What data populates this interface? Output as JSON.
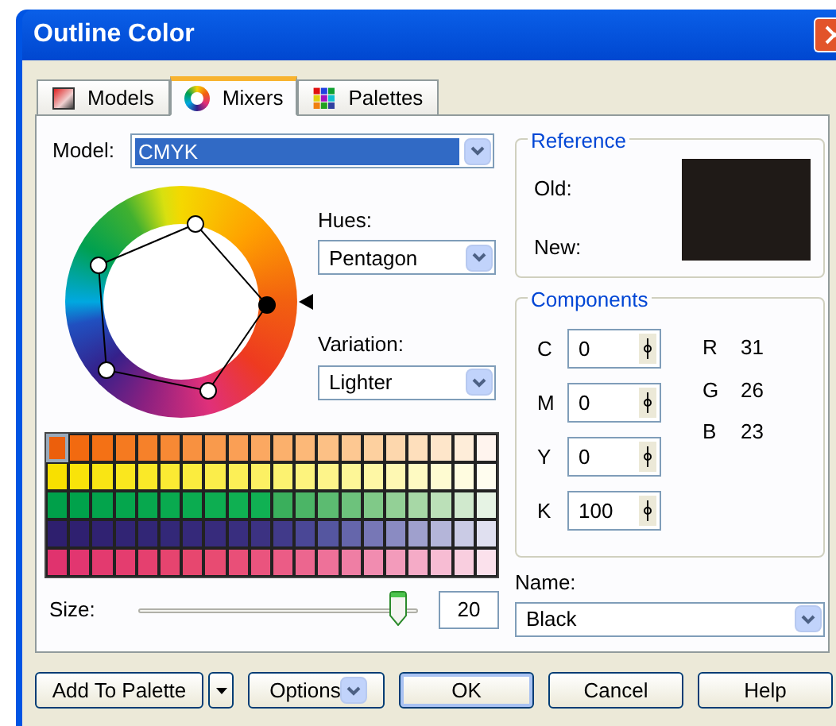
{
  "window": {
    "title": "Outline Color"
  },
  "tabs": [
    {
      "label": "Models",
      "selected": false,
      "kind": "models"
    },
    {
      "label": "Mixers",
      "selected": true,
      "kind": "mixers"
    },
    {
      "label": "Palettes",
      "selected": false,
      "kind": "palettes"
    }
  ],
  "model": {
    "label": "Model:",
    "value": "CMYK"
  },
  "hues": {
    "label": "Hues:",
    "value": "Pentagon"
  },
  "variation": {
    "label": "Variation:",
    "value": "Lighter"
  },
  "swatch_rows": [
    [
      {
        "color": "#ec5f0c",
        "selected": true
      },
      {
        "color": "#f26a10",
        "selected": false
      },
      {
        "color": "#f47115",
        "selected": false
      },
      {
        "color": "#f57a20",
        "selected": false
      },
      {
        "color": "#f6812a",
        "selected": false
      },
      {
        "color": "#f78934",
        "selected": false
      },
      {
        "color": "#f89140",
        "selected": false
      },
      {
        "color": "#f99a4c",
        "selected": false
      },
      {
        "color": "#fa9f55",
        "selected": false
      },
      {
        "color": "#fba861",
        "selected": false
      },
      {
        "color": "#fbb06c",
        "selected": false
      },
      {
        "color": "#fcb878",
        "selected": false
      },
      {
        "color": "#fcc085",
        "selected": false
      },
      {
        "color": "#fdc892",
        "selected": false
      },
      {
        "color": "#fdd09f",
        "selected": false
      },
      {
        "color": "#fdd7ad",
        "selected": false
      },
      {
        "color": "#fedfbc",
        "selected": false
      },
      {
        "color": "#fee6ca",
        "selected": false
      },
      {
        "color": "#feedd9",
        "selected": false
      },
      {
        "color": "#fff4ee",
        "selected": false
      }
    ],
    [
      {
        "color": "#f8e000",
        "selected": false
      },
      {
        "color": "#f9e30a",
        "selected": false
      },
      {
        "color": "#f9e514",
        "selected": false
      },
      {
        "color": "#fae71e",
        "selected": false
      },
      {
        "color": "#fae928",
        "selected": false
      },
      {
        "color": "#fbea33",
        "selected": false
      },
      {
        "color": "#fbec3e",
        "selected": false
      },
      {
        "color": "#fbed4a",
        "selected": false
      },
      {
        "color": "#fcef56",
        "selected": false
      },
      {
        "color": "#fcf063",
        "selected": false
      },
      {
        "color": "#fcf270",
        "selected": false
      },
      {
        "color": "#fdf37d",
        "selected": false
      },
      {
        "color": "#fdf48a",
        "selected": false
      },
      {
        "color": "#fdf697",
        "selected": false
      },
      {
        "color": "#fef7a5",
        "selected": false
      },
      {
        "color": "#fef8b3",
        "selected": false
      },
      {
        "color": "#fefac2",
        "selected": false
      },
      {
        "color": "#fefbd1",
        "selected": false
      },
      {
        "color": "#fffce0",
        "selected": false
      },
      {
        "color": "#fffdef",
        "selected": false
      }
    ],
    [
      {
        "color": "#00a04a",
        "selected": false
      },
      {
        "color": "#00a24b",
        "selected": false
      },
      {
        "color": "#03a44c",
        "selected": false
      },
      {
        "color": "#05a64d",
        "selected": false
      },
      {
        "color": "#07a84e",
        "selected": false
      },
      {
        "color": "#09aa4f",
        "selected": false
      },
      {
        "color": "#0bac50",
        "selected": false
      },
      {
        "color": "#0dae51",
        "selected": false
      },
      {
        "color": "#0fb052",
        "selected": false
      },
      {
        "color": "#10b153",
        "selected": false
      },
      {
        "color": "#3aaf5c",
        "selected": false
      },
      {
        "color": "#4bb566",
        "selected": false
      },
      {
        "color": "#5cbb71",
        "selected": false
      },
      {
        "color": "#6dc27c",
        "selected": false
      },
      {
        "color": "#80c988",
        "selected": false
      },
      {
        "color": "#93d096",
        "selected": false
      },
      {
        "color": "#a7d8a6",
        "selected": false
      },
      {
        "color": "#bbe0b8",
        "selected": false
      },
      {
        "color": "#d0e9cd",
        "selected": false
      },
      {
        "color": "#e6f3e4",
        "selected": false
      }
    ],
    [
      {
        "color": "#2e1f6e",
        "selected": false
      },
      {
        "color": "#2f2070",
        "selected": false
      },
      {
        "color": "#302272",
        "selected": false
      },
      {
        "color": "#312474",
        "selected": false
      },
      {
        "color": "#322676",
        "selected": false
      },
      {
        "color": "#332878",
        "selected": false
      },
      {
        "color": "#35297a",
        "selected": false
      },
      {
        "color": "#372b7c",
        "selected": false
      },
      {
        "color": "#392e7f",
        "selected": false
      },
      {
        "color": "#3c3282",
        "selected": false
      },
      {
        "color": "#413a8a",
        "selected": false
      },
      {
        "color": "#4a4796",
        "selected": false
      },
      {
        "color": "#5556a0",
        "selected": false
      },
      {
        "color": "#6566ab",
        "selected": false
      },
      {
        "color": "#7777b6",
        "selected": false
      },
      {
        "color": "#8a8bc2",
        "selected": false
      },
      {
        "color": "#9fa0cd",
        "selected": false
      },
      {
        "color": "#b4b5d9",
        "selected": false
      },
      {
        "color": "#cacbe5",
        "selected": false
      },
      {
        "color": "#e0e0f0",
        "selected": false
      }
    ],
    [
      {
        "color": "#e0336e",
        "selected": false
      },
      {
        "color": "#e23670",
        "selected": false
      },
      {
        "color": "#e33a6f",
        "selected": false
      },
      {
        "color": "#e43d6f",
        "selected": false
      },
      {
        "color": "#e5406f",
        "selected": false
      },
      {
        "color": "#e6446f",
        "selected": false
      },
      {
        "color": "#e7476f",
        "selected": false
      },
      {
        "color": "#e84b72",
        "selected": false
      },
      {
        "color": "#e94f78",
        "selected": false
      },
      {
        "color": "#ea547e",
        "selected": false
      },
      {
        "color": "#eb5c86",
        "selected": false
      },
      {
        "color": "#ec668f",
        "selected": false
      },
      {
        "color": "#ee7199",
        "selected": false
      },
      {
        "color": "#ef7ea4",
        "selected": false
      },
      {
        "color": "#f18cb0",
        "selected": false
      },
      {
        "color": "#f39bbb",
        "selected": false
      },
      {
        "color": "#f5abc7",
        "selected": false
      },
      {
        "color": "#f7bcd3",
        "selected": false
      },
      {
        "color": "#f9cedf",
        "selected": false
      },
      {
        "color": "#fbe1ec",
        "selected": false
      }
    ]
  ],
  "size": {
    "label": "Size:",
    "level": 0.96,
    "value": "20"
  },
  "reference": {
    "title": "Reference",
    "old_label": "Old:",
    "new_label": "New:"
  },
  "components": {
    "title": "Components",
    "cmyk": [
      {
        "label": "C",
        "value": "0"
      },
      {
        "label": "M",
        "value": "0"
      },
      {
        "label": "Y",
        "value": "0"
      },
      {
        "label": "K",
        "value": "100"
      }
    ],
    "rgb": [
      {
        "label": "R",
        "value": "31"
      },
      {
        "label": "G",
        "value": "26"
      },
      {
        "label": "B",
        "value": "23"
      }
    ]
  },
  "name": {
    "label": "Name:",
    "value": "Black"
  },
  "buttons": [
    {
      "label": "Add To Palette",
      "kind": "split"
    },
    {
      "label": "Options",
      "kind": "menu"
    },
    {
      "label": "OK",
      "kind": "default"
    },
    {
      "label": "Cancel",
      "kind": "plain"
    },
    {
      "label": "Help",
      "kind": "plain"
    }
  ]
}
